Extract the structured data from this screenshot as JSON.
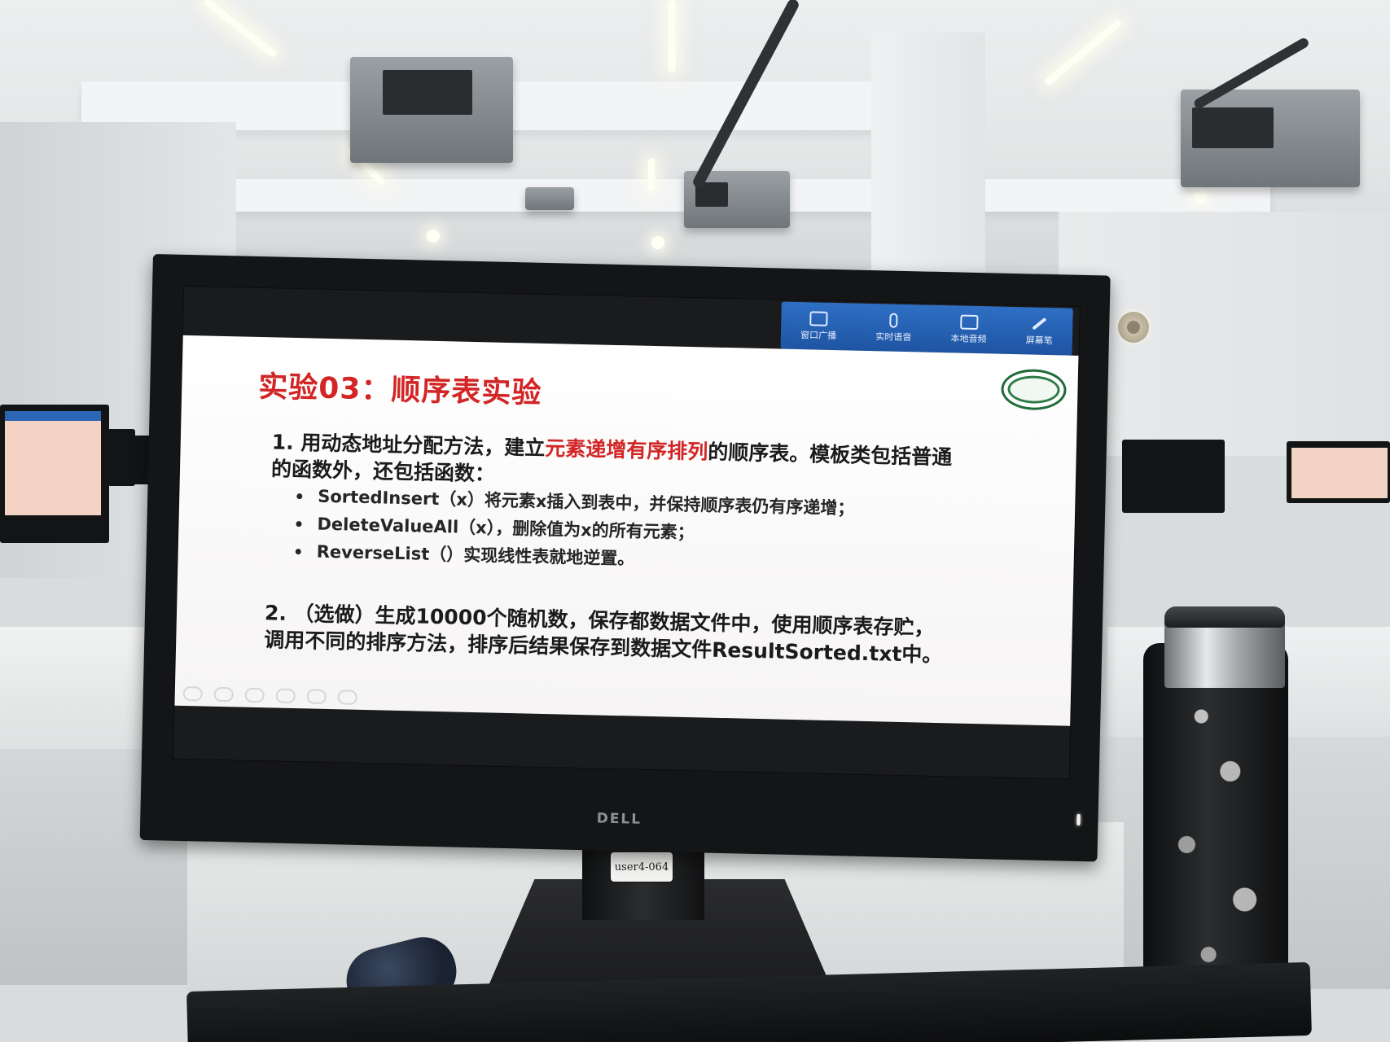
{
  "slide": {
    "title": "实验03：顺序表实验",
    "para1_before": "1. 用动态地址分配方法，建立",
    "para1_highlight": "元素递增有序排列",
    "para1_after": "的顺序表。模板类包括普通的函数外，还包括函数：",
    "bullets": [
      "SortedInsert（x）将元素x插入到表中，并保持顺序表仍有序递增；",
      "DeleteValueAll（x），删除值为x的所有元素；",
      "ReverseList（）实现线性表就地逆置。"
    ],
    "para2": "2. （选做）生成10000个随机数，保存都数据文件中，使用顺序表存贮， 调用不同的排序方法，排序后结果保存到数据文件ResultSorted.txt中。"
  },
  "toolbar": {
    "items": [
      "窗口广播",
      "实时语音",
      "本地音频",
      "屏幕笔"
    ]
  },
  "monitor": {
    "brand": "DELL",
    "label": "user4-064"
  },
  "colors": {
    "title_red": "#d32525",
    "toolbar_blue": "#1f54a3"
  }
}
